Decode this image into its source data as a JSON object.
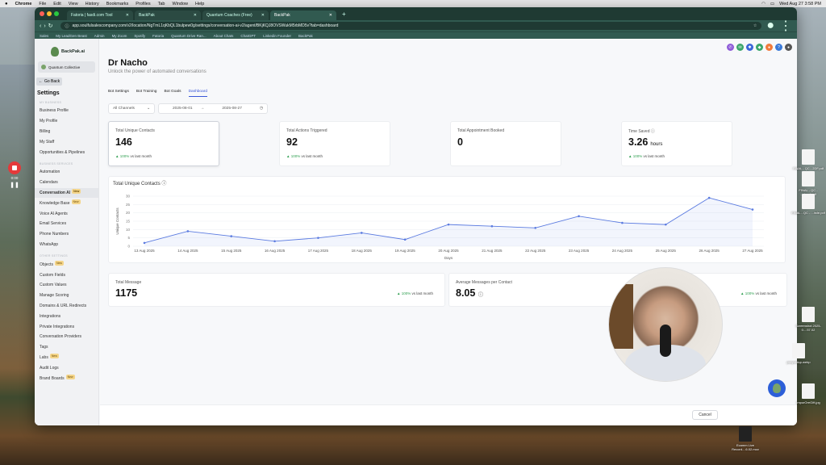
{
  "menubar": {
    "app": "Chrome",
    "items": [
      "File",
      "Edit",
      "View",
      "History",
      "Bookmarks",
      "Profiles",
      "Tab",
      "Window",
      "Help"
    ],
    "datetime": "Wed Aug 27  3:58 PM"
  },
  "browser": {
    "tabs": [
      {
        "label": "Fatoria | fasdi.com Tool"
      },
      {
        "label": "BackPak"
      },
      {
        "label": "Quantum Coaches (Free)"
      },
      {
        "label": "BackPak"
      }
    ],
    "url": "app.soulfulsalescompany.com/v2/location/NgTmL1qKbQL1bulpew0g/settings/conversation-ai-v2/agent/BKjKQJ8OVSWukM5rbMD5v?tab=dashboard",
    "bookmarks": [
      "Sales",
      "My LeadGen Beast",
      "Admin",
      "My Zoom",
      "Spotify",
      "Fatoria",
      "Quantum Drive Ran...",
      "About Chats",
      "ChatGPT",
      "Linkedin Founder",
      "BackPak"
    ]
  },
  "sidebar": {
    "brand": "BackPak.ai",
    "account": "Quantum Collective",
    "back_label": "Go Back",
    "title": "Settings",
    "section1": "MY BUSINESS",
    "items1": [
      "Business Profile",
      "My Profile",
      "Billing",
      "My Staff",
      "Opportunities & Pipelines"
    ],
    "section2": "BUSINESS SERVICES",
    "items2": [
      {
        "label": "Automation"
      },
      {
        "label": "Calendars"
      },
      {
        "label": "Conversation AI",
        "badge": "New"
      },
      {
        "label": "Knowledge Base",
        "badge": "New"
      },
      {
        "label": "Voice AI Agents"
      },
      {
        "label": "Email Services"
      },
      {
        "label": "Phone Numbers"
      },
      {
        "label": "WhatsApp"
      }
    ],
    "section3": "OTHER SETTINGS",
    "items3": [
      {
        "label": "Objects",
        "badge": "New"
      },
      {
        "label": "Custom Fields"
      },
      {
        "label": "Custom Values"
      },
      {
        "label": "Manage Scoring"
      },
      {
        "label": "Domains & URL Redirects"
      },
      {
        "label": "Integrations"
      },
      {
        "label": "Private Integrations"
      },
      {
        "label": "Conversation Providers"
      },
      {
        "label": "Tags"
      },
      {
        "label": "Labs",
        "badge": "New"
      },
      {
        "label": "Audit Logs"
      },
      {
        "label": "Brand Boards",
        "badge": "New"
      }
    ]
  },
  "main": {
    "title": "Dr Nacho",
    "subtitle": "Unlock the power of automated conversations",
    "tabs": [
      "Bot Settings",
      "Bot Training",
      "Bot Goals",
      "Dashboard"
    ],
    "channel_filter": "All Channels",
    "date_start": "2025-08-01",
    "date_sep": "→",
    "date_end": "2025-08-27",
    "kpis": [
      {
        "label": "Total Unique Contacts",
        "value": "146",
        "unit": "",
        "change": "100%",
        "suffix": "vs last month"
      },
      {
        "label": "Total Actions Triggered",
        "value": "92",
        "unit": "",
        "change": "100%",
        "suffix": "vs last month"
      },
      {
        "label": "Total Appointment Booked",
        "value": "0",
        "unit": "",
        "change": "",
        "suffix": ""
      },
      {
        "label": "Time Saved",
        "value": "3.26",
        "unit": "hours",
        "change": "100%",
        "suffix": "vs last month"
      }
    ],
    "bottom_cards": [
      {
        "label": "Total Message",
        "value": "1175",
        "change": "100%",
        "suffix": "vs last month"
      },
      {
        "label": "Average Messages per Contact",
        "value": "8.05",
        "change": "100%",
        "suffix": "vs last month"
      }
    ],
    "cancel_label": "Cancel"
  },
  "chart_data": {
    "type": "line",
    "title": "Total Unique Contacts",
    "xlabel": "Days",
    "ylabel": "Unique Contacts",
    "categories": [
      "13 Aug 2025",
      "14 Aug 2025",
      "15 Aug 2025",
      "16 Aug 2025",
      "17 Aug 2025",
      "18 Aug 2025",
      "19 Aug 2025",
      "20 Aug 2025",
      "21 Aug 2025",
      "22 Aug 2025",
      "23 Aug 2025",
      "24 Aug 2025",
      "25 Aug 2025",
      "26 Aug 2025",
      "27 Aug 2025"
    ],
    "values": [
      2,
      9,
      6,
      3,
      5,
      8,
      4,
      13,
      12,
      11,
      18,
      14,
      13,
      29,
      22
    ],
    "ylim": [
      0,
      30
    ],
    "yticks": [
      0,
      5,
      10,
      15,
      20,
      25,
      30
    ],
    "grid": true,
    "color": "#5b7be0"
  },
  "recorder": {
    "time": "0:00"
  },
  "desktop_icons": [
    {
      "label": "FINAL - QC - 2DF.pdf"
    },
    {
      "label": "FINAL - QC - ...sheet.pdf"
    },
    {
      "label": "FINAL - QC - ...ircle.pdf"
    },
    {
      "label": "Screenshot 2025-0....57.02"
    },
    {
      "label": "pccyordup.webp"
    },
    {
      "label": "ImpurOreGift.jpg"
    },
    {
      "label": "Ecamm Live Record....6.02.mov"
    }
  ],
  "colors": {
    "accent": "#3a57d8",
    "up": "#2e9e4f",
    "tabbar": "#1f3a33",
    "record": "#e5393a"
  }
}
